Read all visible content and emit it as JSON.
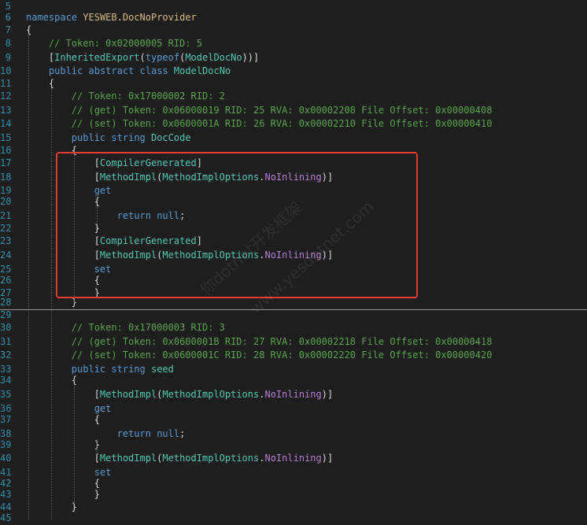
{
  "editor": {
    "colors": {
      "keyword": "#569cd6",
      "comment": "#57a64a",
      "type": "#4ec9b0",
      "namespace": "#d7ba7d",
      "enum_member": "#b87dd6",
      "plain": "#dcdcdc",
      "line_number": "#2b91af",
      "highlight_box": "#e53935"
    },
    "lines": [
      {
        "n": "5",
        "t": ""
      },
      {
        "n": "6",
        "t": "namespace YESWEB.DocNoProvider"
      },
      {
        "n": "7",
        "t": "{"
      },
      {
        "n": "8",
        "t": "    // Token: 0x02000005 RID: 5"
      },
      {
        "n": "9",
        "t": "    [InheritedExport(typeof(ModelDocNo))]"
      },
      {
        "n": "10",
        "t": "    public abstract class ModelDocNo"
      },
      {
        "n": "11",
        "t": "    {"
      },
      {
        "n": "12",
        "t": "        // Token: 0x17000002 RID: 2"
      },
      {
        "n": "13",
        "t": "        // (get) Token: 0x06000019 RID: 25 RVA: 0x00002208 File Offset: 0x00000408"
      },
      {
        "n": "14",
        "t": "        // (set) Token: 0x0600001A RID: 26 RVA: 0x00002210 File Offset: 0x00000410"
      },
      {
        "n": "15",
        "t": "        public string DocCode"
      },
      {
        "n": "16",
        "t": "        {"
      },
      {
        "n": "17",
        "t": "            [CompilerGenerated]"
      },
      {
        "n": "18",
        "t": "            [MethodImpl(MethodImplOptions.NoInlining)]"
      },
      {
        "n": "19",
        "t": "            get"
      },
      {
        "n": "20",
        "t": "            {"
      },
      {
        "n": "21",
        "t": "                return null;"
      },
      {
        "n": "22",
        "t": "            }"
      },
      {
        "n": "23",
        "t": "            [CompilerGenerated]"
      },
      {
        "n": "24",
        "t": "            [MethodImpl(MethodImplOptions.NoInlining)]"
      },
      {
        "n": "25",
        "t": "            set"
      },
      {
        "n": "26",
        "t": "            {"
      },
      {
        "n": "27",
        "t": "            }"
      },
      {
        "n": "28",
        "t": "        }"
      },
      {
        "n": "29",
        "t": ""
      },
      {
        "n": "30",
        "t": "        // Token: 0x17000003 RID: 3"
      },
      {
        "n": "31",
        "t": "        // (get) Token: 0x0600001B RID: 27 RVA: 0x00002218 File Offset: 0x00000418"
      },
      {
        "n": "32",
        "t": "        // (set) Token: 0x0600001C RID: 28 RVA: 0x00002220 File Offset: 0x00000420"
      },
      {
        "n": "33",
        "t": "        public string seed"
      },
      {
        "n": "34",
        "t": "        {"
      },
      {
        "n": "35",
        "t": "            [MethodImpl(MethodImplOptions.NoInlining)]"
      },
      {
        "n": "36",
        "t": "            get"
      },
      {
        "n": "37",
        "t": "            {"
      },
      {
        "n": "38",
        "t": "                return null;"
      },
      {
        "n": "39",
        "t": "            }"
      },
      {
        "n": "40",
        "t": "            [MethodImpl(MethodImplOptions.NoInlining)]"
      },
      {
        "n": "41",
        "t": "            set"
      },
      {
        "n": "42",
        "t": "            {"
      },
      {
        "n": "43",
        "t": "            }"
      },
      {
        "n": "44",
        "t": "        }"
      },
      {
        "n": "45",
        "t": ""
      }
    ]
  },
  "watermark": {
    "text_1": "你dotnet开发框架",
    "text_2": "www.yesdotnet.com"
  }
}
